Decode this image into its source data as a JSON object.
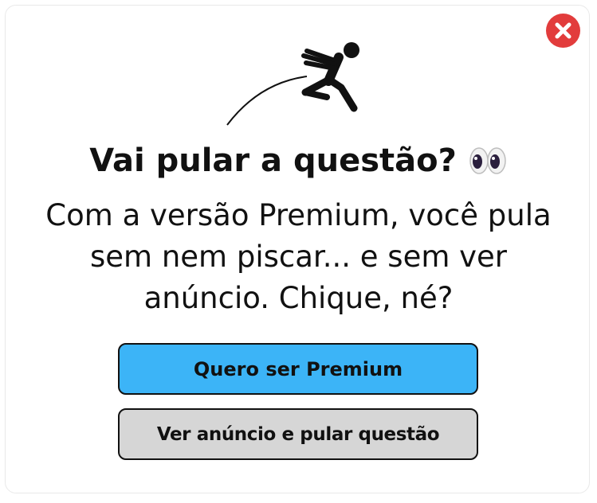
{
  "dialog": {
    "title": "Vai pular a questão?",
    "title_emoji": "eyes-icon",
    "message": "Com a versão Premium, você pula sem nem piscar... e sem ver anúncio. Chique, né?",
    "close_icon": "close-icon",
    "illustration_icon": "jumping-person-icon",
    "buttons": {
      "premium_label": "Quero ser Premium",
      "skip_with_ad_label": "Ver anúncio e pular questão"
    }
  },
  "colors": {
    "close_button": "#e23c3c",
    "premium_button": "#3cb4f7",
    "ad_button": "#d6d6d6",
    "text": "#111111"
  }
}
